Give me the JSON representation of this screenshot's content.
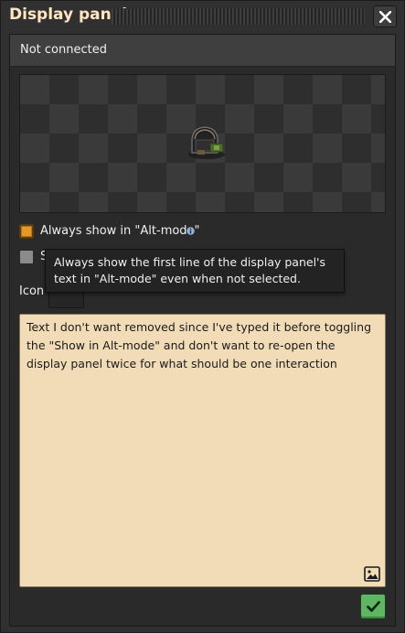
{
  "window": {
    "title": "Display panel"
  },
  "status": {
    "text": "Not connected"
  },
  "options": {
    "always_show_alt_mode": {
      "label": "Always show in \"Alt-mode\"",
      "checked": true
    },
    "second_option": {
      "label": "S",
      "checked": false
    }
  },
  "icon": {
    "label": "Icon"
  },
  "tooltip": {
    "text": "Always show the first line of the display panel's text in \"Alt-mode\" even when not selected."
  },
  "message": {
    "value": "Text I don't want removed since I've typed it before toggling the \"Show in Alt-mode\" and don't want to re-open the display panel twice for what should be one interaction"
  },
  "icons": {
    "close": "close-icon",
    "info": "info-icon",
    "image": "image-icon",
    "confirm": "checkmark-icon"
  },
  "colors": {
    "title": "#ffe6c0",
    "checkbox_checked": "#e39827",
    "textarea_bg": "#f2dcb8",
    "confirm": "#5eb663"
  }
}
